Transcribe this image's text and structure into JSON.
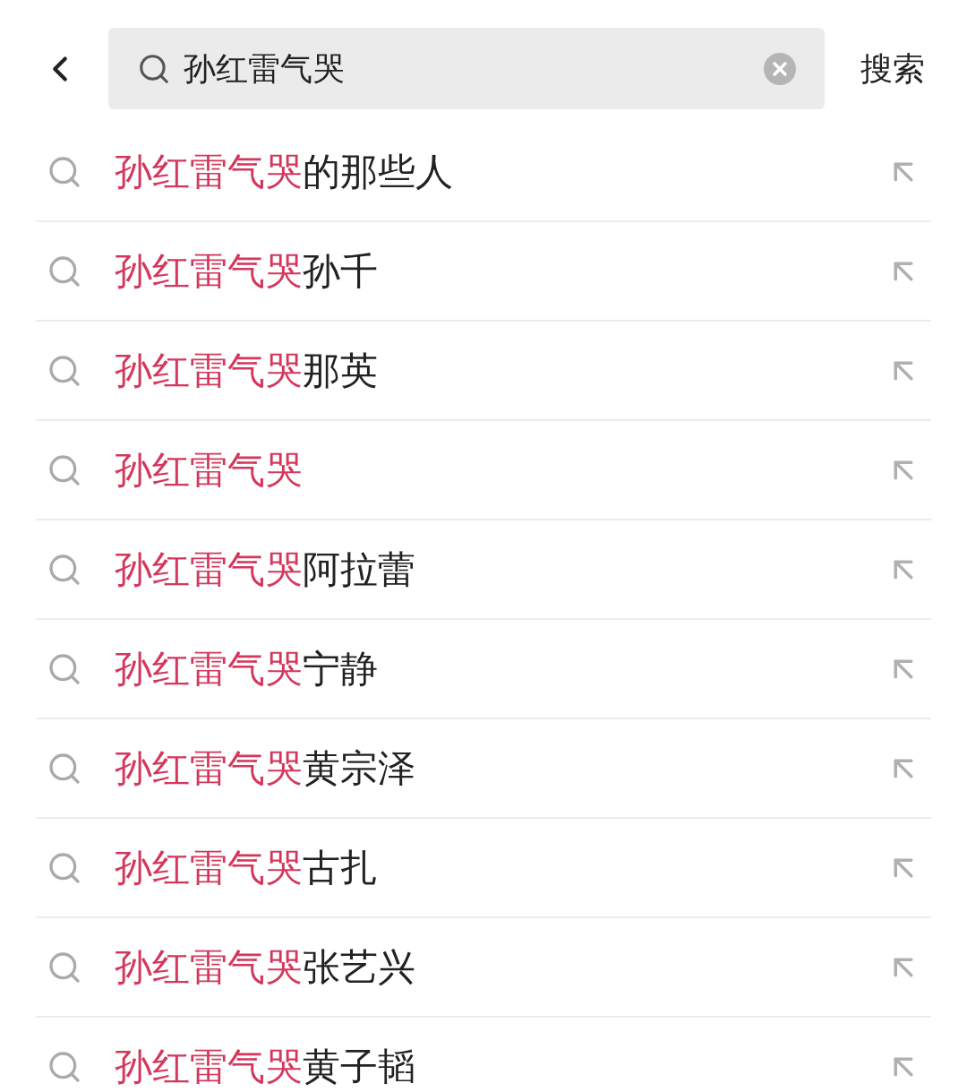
{
  "search": {
    "value": "孙红雷气哭",
    "button": "搜索"
  },
  "suggestions": [
    {
      "match": "孙红雷气哭",
      "rest": "的那些人"
    },
    {
      "match": "孙红雷气哭",
      "rest": "孙千"
    },
    {
      "match": "孙红雷气哭",
      "rest": "那英"
    },
    {
      "match": "孙红雷气哭"
    },
    {
      "match": "孙红雷气哭",
      "rest": "阿拉蕾"
    },
    {
      "match": "孙红雷气哭",
      "rest": "宁静"
    },
    {
      "match": "孙红雷气哭",
      "rest": "黄宗泽"
    },
    {
      "match": "孙红雷气哭",
      "rest": "古扎"
    },
    {
      "match": "孙红雷气哭",
      "rest": "张艺兴"
    },
    {
      "match": "孙红雷气哭",
      "rest": "黄子韬"
    }
  ]
}
